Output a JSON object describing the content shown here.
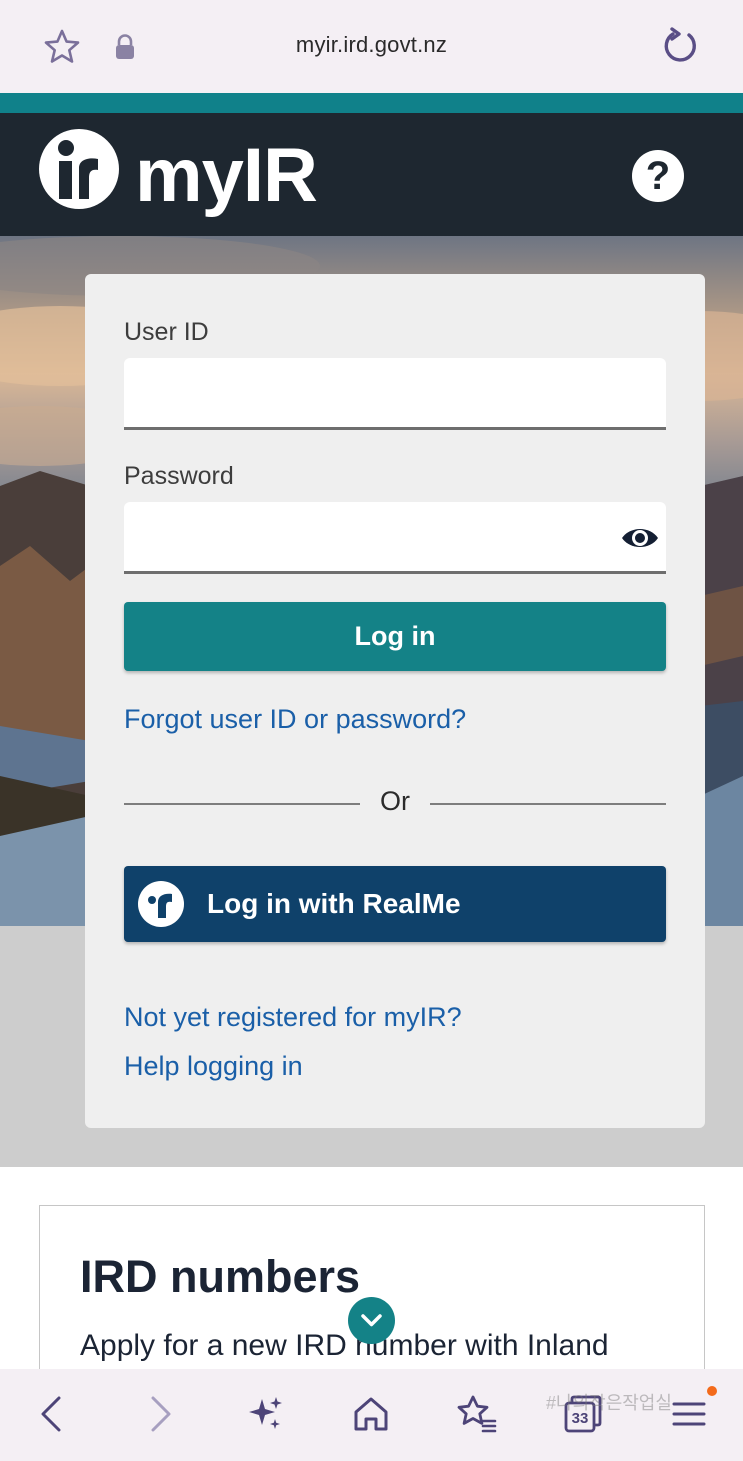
{
  "browser": {
    "url": "myir.ird.govt.nz",
    "tab_count": "33",
    "watermark": "#나의작은작업실",
    "icons": [
      "star-icon",
      "lock-icon",
      "reload-icon",
      "back-icon",
      "forward-icon",
      "sparkle-icon",
      "home-icon",
      "bookmarks-icon",
      "tabs-icon",
      "menu-icon"
    ]
  },
  "header": {
    "brand": "myIR",
    "help_label": "?"
  },
  "login": {
    "user_id_label": "User ID",
    "user_id_value": "",
    "password_label": "Password",
    "password_value": "",
    "login_button": "Log in",
    "forgot_link": "Forgot user ID or password?",
    "or_text": "Or",
    "realme_button": "Log in with RealMe",
    "register_link": "Not yet registered for myIR?",
    "help_link": "Help logging in"
  },
  "info": {
    "title": "IRD numbers",
    "text": "Apply for a new IRD number with Inland"
  },
  "colors": {
    "teal": "#148287",
    "header_dark": "#1e2730",
    "realme_navy": "#0f416a",
    "link_blue": "#1a5fa8"
  }
}
